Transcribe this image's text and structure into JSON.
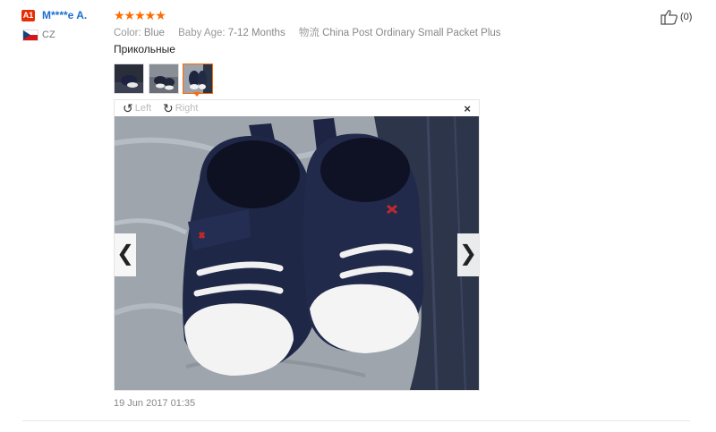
{
  "reviewer": {
    "level": "A1",
    "name": "M****e A.",
    "country": "CZ",
    "flag_icon": "czech-flag-icon"
  },
  "rating": {
    "stars": 5,
    "display": "★★★★★"
  },
  "attributes": [
    {
      "key": "Color:",
      "value": "Blue"
    },
    {
      "key": "Baby Age:",
      "value": "7-12 Months"
    },
    {
      "key": "物流",
      "value": "China Post Ordinary Small Packet Plus"
    }
  ],
  "review": {
    "text": "Прикольные"
  },
  "viewer": {
    "rotate_left": "Left",
    "rotate_right": "Right",
    "close": "×",
    "prev": "❮",
    "next": "❯"
  },
  "date": "19 Jun 2017 01:35",
  "likes": {
    "count_label": "(0)"
  },
  "colors": {
    "accent": "#ff6a00",
    "link": "#1a6fcf",
    "badge": "#e62e04"
  }
}
